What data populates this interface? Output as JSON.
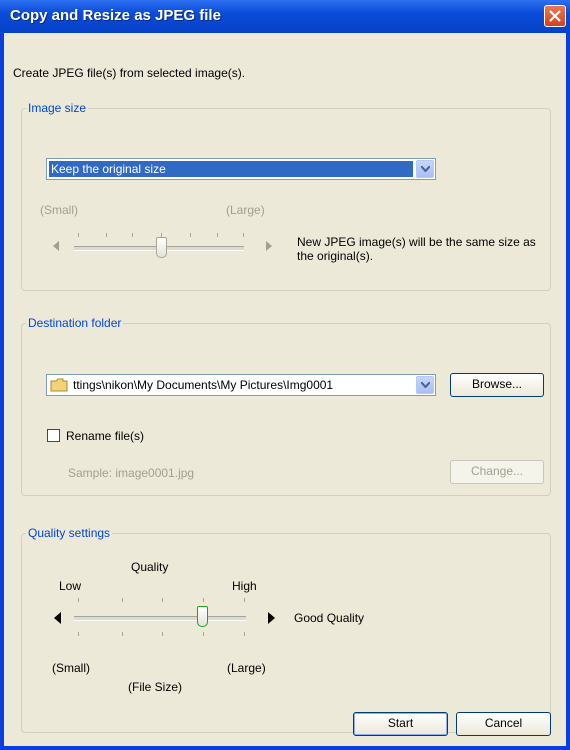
{
  "window": {
    "title": "Copy and Resize as JPEG file"
  },
  "description": "Create JPEG file(s) from selected image(s).",
  "image_size": {
    "legend": "Image size",
    "selected": "Keep the original size",
    "small": "(Small)",
    "large": "(Large)",
    "note": "New JPEG image(s) will be the same size as the original(s)."
  },
  "destination": {
    "legend": "Destination folder",
    "path": "ttings\\nikon\\My Documents\\My Pictures\\Img0001",
    "browse": "Browse...",
    "rename": "Rename file(s)",
    "sample": "Sample: image0001.jpg",
    "change": "Change..."
  },
  "quality": {
    "legend": "Quality settings",
    "quality_label": "Quality",
    "low": "Low",
    "high": "High",
    "status": "Good Quality",
    "small": "(Small)",
    "large": "(Large)",
    "file_size": "(File Size)"
  },
  "buttons": {
    "start": "Start",
    "cancel": "Cancel"
  }
}
